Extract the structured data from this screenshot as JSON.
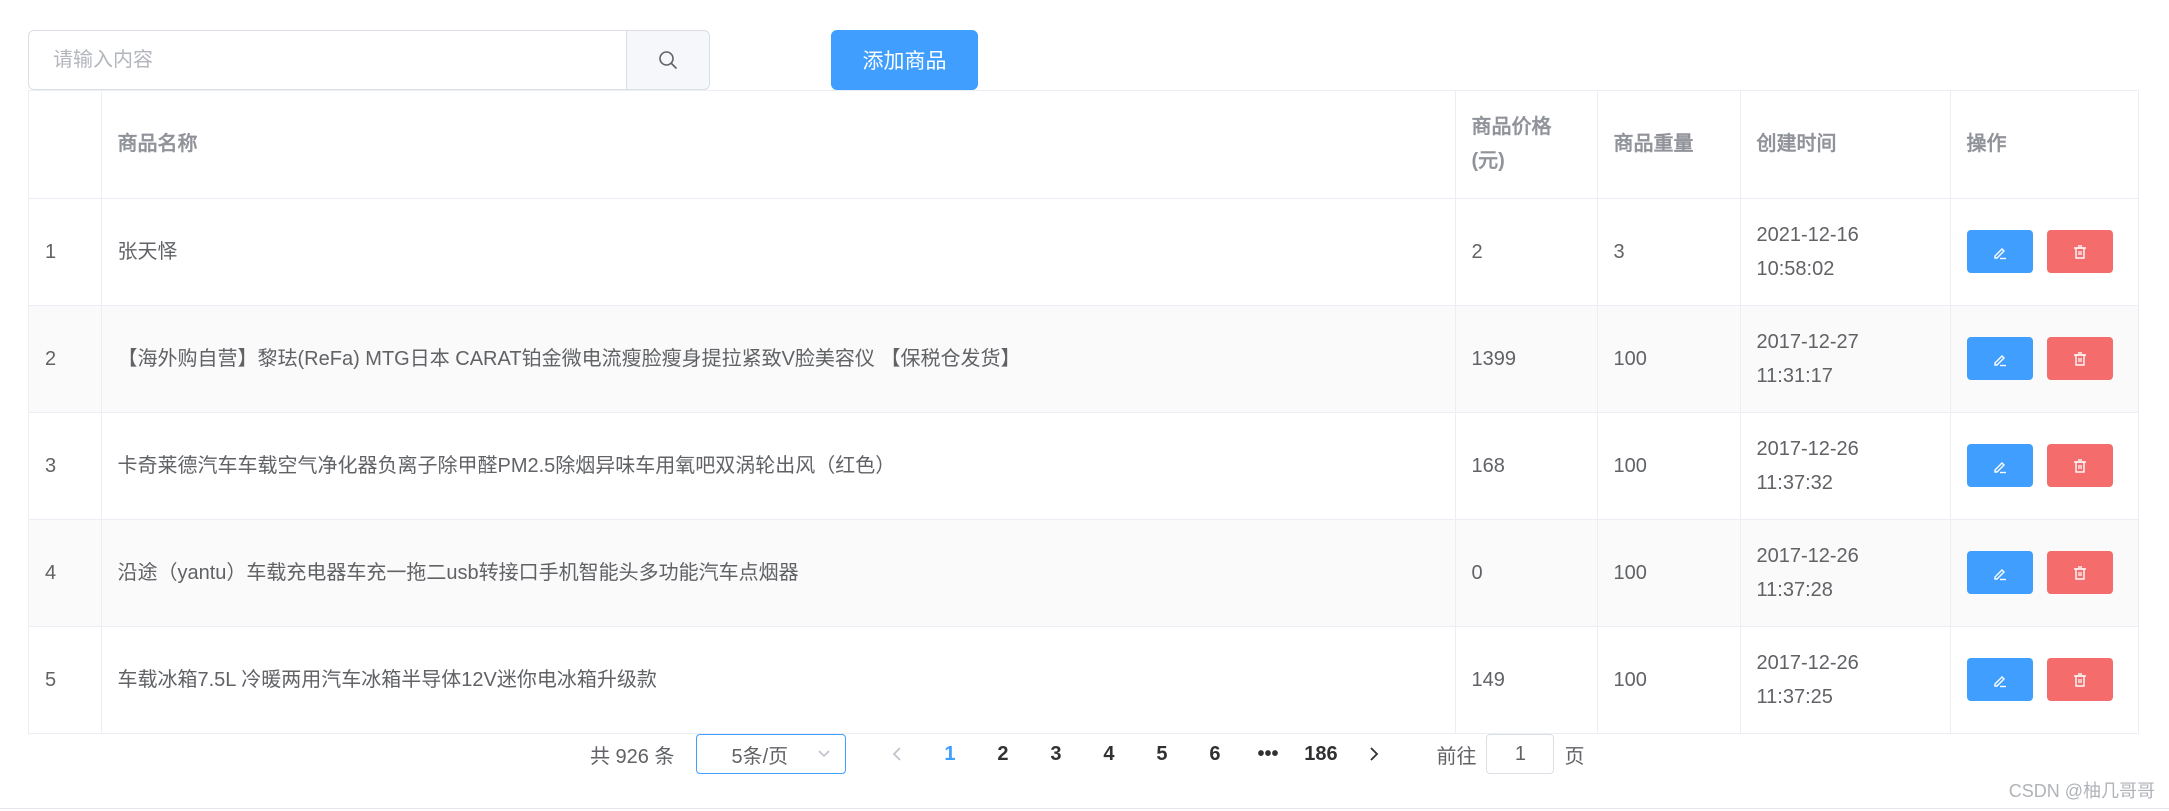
{
  "search": {
    "placeholder": "请输入内容",
    "value": "",
    "icon": "search-icon"
  },
  "toolbar": {
    "add_label": "添加商品",
    "accent": "#409eff"
  },
  "table": {
    "headers": {
      "index": "",
      "name": "商品名称",
      "price": "商品价格(元)",
      "weight": "商品重量",
      "time": "创建时间",
      "ops": "操作"
    },
    "rows": [
      {
        "index": "1",
        "name": "张天怿",
        "price": "2",
        "weight": "3",
        "time": "2021-12-16 10:58:02"
      },
      {
        "index": "2",
        "name": "【海外购自营】黎珐(ReFa) MTG日本 CARAT铂金微电流瘦脸瘦身提拉紧致V脸美容仪 【保税仓发货】",
        "price": "1399",
        "weight": "100",
        "time": "2017-12-27 11:31:17"
      },
      {
        "index": "3",
        "name": "卡奇莱德汽车车载空气净化器负离子除甲醛PM2.5除烟异味车用氧吧双涡轮出风（红色）",
        "price": "168",
        "weight": "100",
        "time": "2017-12-26 11:37:32"
      },
      {
        "index": "4",
        "name": "沿途（yantu）车载充电器车充一拖二usb转接口手机智能头多功能汽车点烟器",
        "price": "0",
        "weight": "100",
        "time": "2017-12-26 11:37:28"
      },
      {
        "index": "5",
        "name": "车载冰箱7.5L 冷暖两用汽车冰箱半导体12V迷你电冰箱升级款",
        "price": "149",
        "weight": "100",
        "time": "2017-12-26 11:37:25"
      }
    ],
    "edit_color": "#409eff",
    "delete_color": "#f56c6c"
  },
  "pagination": {
    "total_text": "共 926 条",
    "page_size": "5条/页",
    "current": "1",
    "pages": [
      "1",
      "2",
      "3",
      "4",
      "5",
      "6"
    ],
    "ellipsis": "•••",
    "last": "186",
    "goto_label": "前往",
    "goto_value": "1",
    "goto_suffix": "页"
  },
  "watermark": "CSDN @柚几哥哥"
}
